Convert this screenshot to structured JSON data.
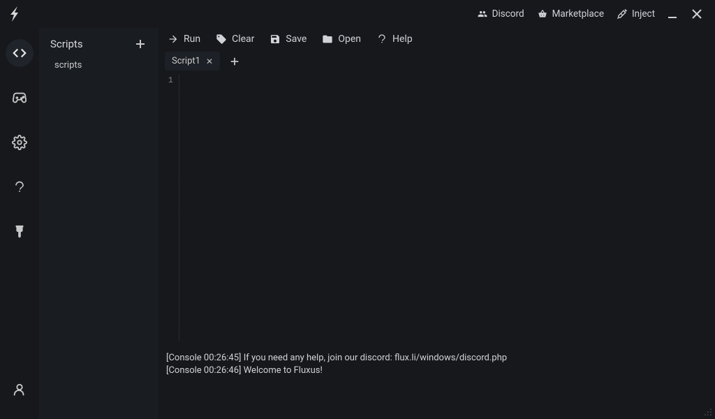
{
  "titlebar": {
    "discord": "Discord",
    "marketplace": "Marketplace",
    "inject": "Inject"
  },
  "sidebar": {
    "title": "Scripts",
    "items": [
      "scripts"
    ]
  },
  "toolbar": {
    "run": "Run",
    "clear": "Clear",
    "save": "Save",
    "open": "Open",
    "help": "Help"
  },
  "tabs": [
    "Script1"
  ],
  "editor": {
    "line_numbers": [
      "1"
    ],
    "content": ""
  },
  "console": {
    "lines": [
      "[Console 00:26:45] If you need any help, join our discord: flux.li/windows/discord.php",
      "[Console 00:26:46] Welcome to Fluxus!"
    ]
  }
}
